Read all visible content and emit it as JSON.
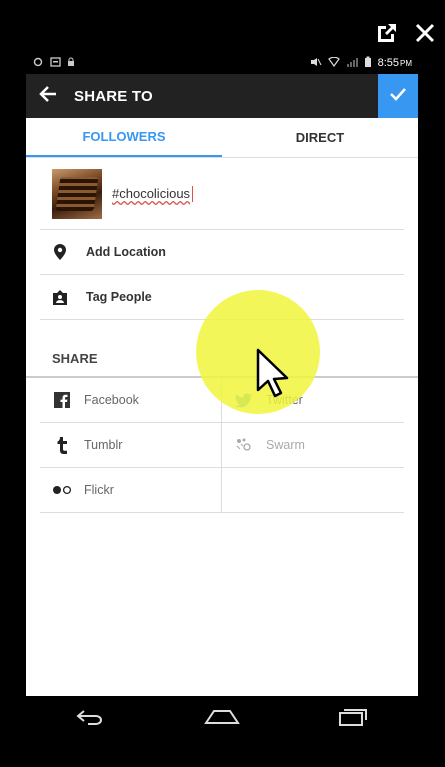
{
  "status_bar": {
    "time": "8:55",
    "ampm": "PM"
  },
  "header": {
    "title": "SHARE TO"
  },
  "tabs": [
    {
      "label": "FOLLOWERS",
      "active": true
    },
    {
      "label": "DIRECT",
      "active": false
    }
  ],
  "caption": {
    "text": "#chocolicious"
  },
  "options": {
    "add_location": "Add Location",
    "tag_people": "Tag People"
  },
  "share": {
    "header": "SHARE",
    "services": [
      {
        "label": "Facebook",
        "icon": "facebook-icon"
      },
      {
        "label": "Twitter",
        "icon": "twitter-icon"
      },
      {
        "label": "Tumblr",
        "icon": "tumblr-icon"
      },
      {
        "label": "Swarm",
        "icon": "swarm-icon"
      },
      {
        "label": "Flickr",
        "icon": "flickr-icon"
      }
    ]
  },
  "colors": {
    "accent": "#3897f0",
    "action_bar": "#222222",
    "highlight": "#f0f53c"
  }
}
